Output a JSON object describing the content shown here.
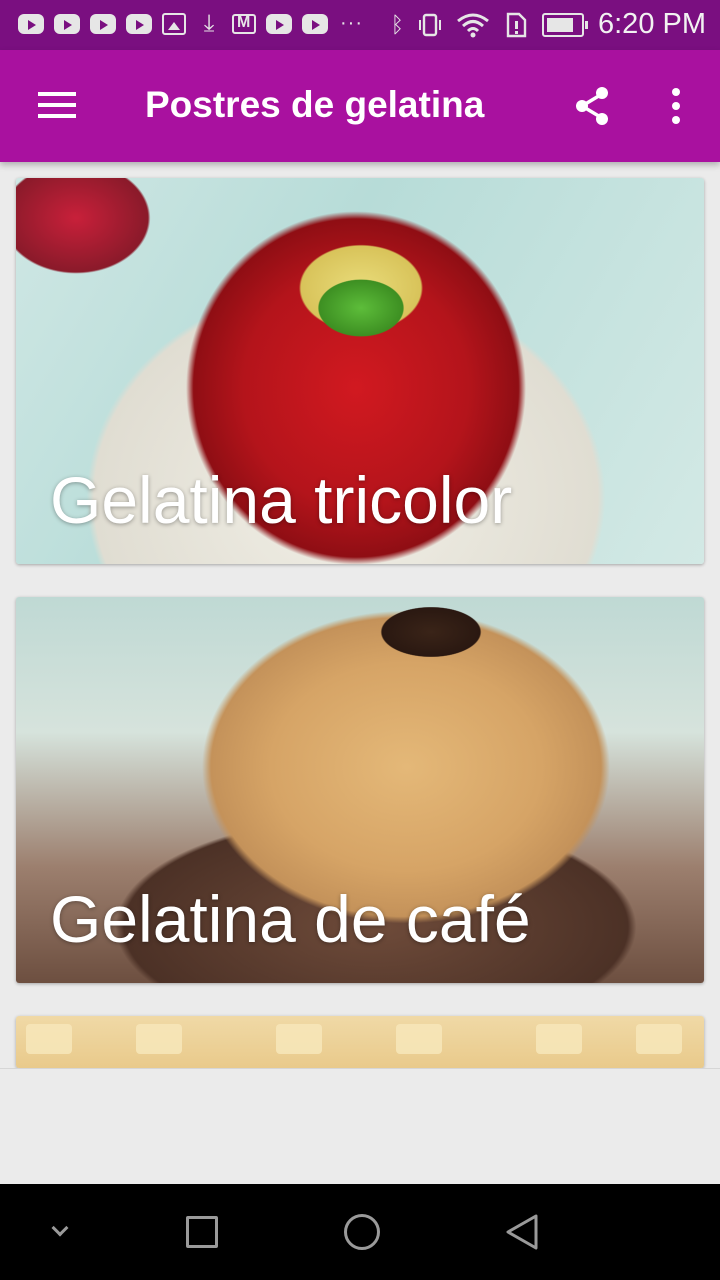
{
  "status_bar": {
    "time": "6:20 PM",
    "overflow": "···",
    "left_icons": [
      "youtube-icon",
      "youtube-icon",
      "youtube-icon",
      "youtube-icon",
      "image-icon",
      "download-icon",
      "gmail-icon",
      "youtube-icon",
      "youtube-icon"
    ],
    "right_icons": [
      "bluetooth-icon",
      "vibrate-icon",
      "wifi-icon",
      "sim-icon",
      "battery-icon"
    ]
  },
  "app_bar": {
    "title": "Postres de gelatina",
    "background": "#a9119f",
    "actions": [
      "share-icon",
      "more-vert-icon"
    ]
  },
  "cards": [
    {
      "title": "Gelatina tricolor"
    },
    {
      "title": "Gelatina de café"
    },
    {
      "title": ""
    }
  ],
  "nav_bar": {
    "buttons": [
      "chevron-down-icon",
      "recents-icon",
      "home-icon",
      "back-icon"
    ]
  }
}
